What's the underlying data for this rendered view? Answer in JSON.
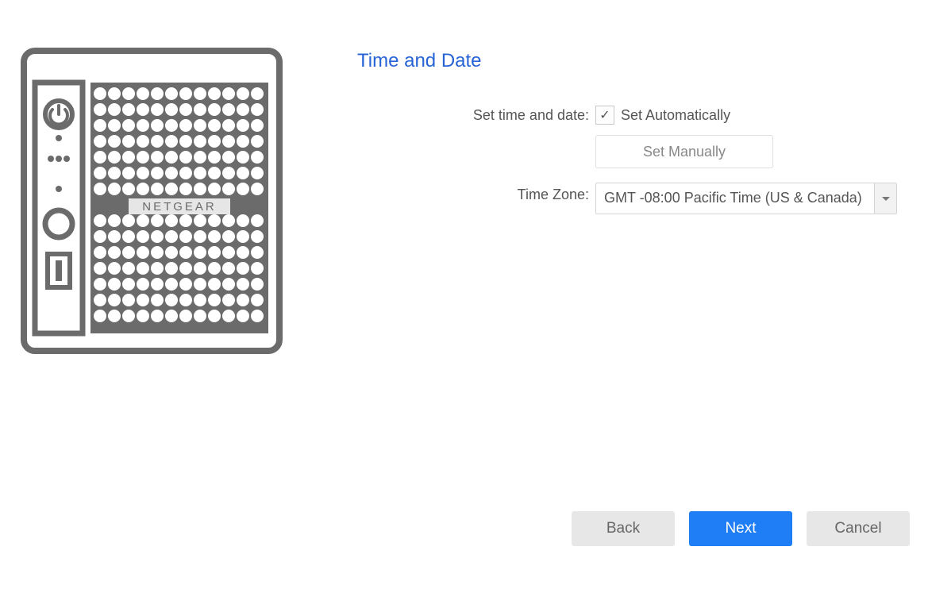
{
  "header": {
    "title": "Time and Date"
  },
  "device": {
    "brand_label": "NETGEAR"
  },
  "form": {
    "set_time_label": "Set time and date:",
    "set_auto_checked": true,
    "set_auto_label": "Set Automatically",
    "set_manually_label": "Set Manually",
    "timezone_label": "Time Zone:",
    "timezone_value": "GMT -08:00 Pacific Time (US & Canada)"
  },
  "footer": {
    "back_label": "Back",
    "next_label": "Next",
    "cancel_label": "Cancel"
  },
  "icons": {
    "checkmark": "✓"
  }
}
